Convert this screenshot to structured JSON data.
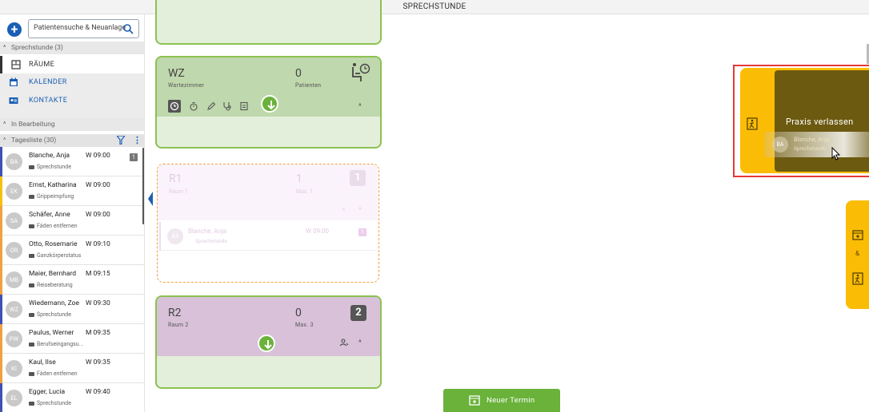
{
  "header": {
    "title": "SPRECHSTUNDE"
  },
  "search": {
    "placeholder": "Patientensuche & Neuanlage"
  },
  "sections": {
    "sprechstunde": "Sprechstunde (3)",
    "in_bearbeitung": "In Bearbeitung",
    "tagesliste": "Tagesliste (30)"
  },
  "nav": {
    "raeume": "RÄUME",
    "kalender": "KALENDER",
    "kontakte": "KONTAKTE"
  },
  "patients": [
    {
      "initials": "BA",
      "name": "Blanche, Anja",
      "time": "W 09:00",
      "reason": "Sprechstunde",
      "bar": "#3f51b5",
      "badge": "1"
    },
    {
      "initials": "EK",
      "name": "Ernst, Katharina",
      "time": "W 09:00",
      "reason": "Grippeimpfung",
      "bar": "#f4c20d",
      "badge": ""
    },
    {
      "initials": "SA",
      "name": "Schäfer, Anne",
      "time": "W 09:00",
      "reason": "Fäden entfernen",
      "bar": "#f0a040",
      "badge": ""
    },
    {
      "initials": "OR",
      "name": "Otto, Rosemarie",
      "time": "W 09:10",
      "reason": "Ganzkörperstatus",
      "bar": "#f0a040",
      "badge": ""
    },
    {
      "initials": "MB",
      "name": "Maier, Bernhard",
      "time": "M 09:15",
      "reason": "Reiseberatung",
      "bar": "#f0a040",
      "badge": ""
    },
    {
      "initials": "WZ",
      "name": "Wiedemann, Zoe",
      "time": "W 09:30",
      "reason": "Sprechstunde",
      "bar": "#3f51b5",
      "badge": ""
    },
    {
      "initials": "PW",
      "name": "Paulus, Werner",
      "time": "M 09:35",
      "reason": "Berufseingangsu...",
      "bar": "#f0a040",
      "badge": ""
    },
    {
      "initials": "KI",
      "name": "Kaul, Ilse",
      "time": "W 09:35",
      "reason": "Fäden entfernen",
      "bar": "#f0a040",
      "badge": ""
    },
    {
      "initials": "EL",
      "name": "Egger, Lucia",
      "time": "W 09:40",
      "reason": "Sprechstunde",
      "bar": "#3f51b5",
      "badge": ""
    }
  ],
  "rooms": {
    "wz": {
      "title": "WZ",
      "subtitle": "Wartezimmer",
      "count": "0",
      "count_label": "Patienten"
    },
    "r1": {
      "title": "R1",
      "subtitle": "Raum 1",
      "count": "1",
      "count_label": "Max. 1",
      "badge": "1",
      "patient": {
        "initials": "BA",
        "name": "Blanche, Anja",
        "reason": "Sprechstunde",
        "time": "W 09:00",
        "badge": "1"
      }
    },
    "r2": {
      "title": "R2",
      "subtitle": "Raum 2",
      "count": "0",
      "count_label": "Max. 3",
      "badge": "2"
    }
  },
  "praxis": {
    "label": "Praxis verlassen",
    "drag_name": "Blanche, Anja",
    "drag_reason": "Sprechstunde",
    "drag_initials": "BA"
  },
  "right_tab": {
    "amp": "&"
  },
  "new_termin": {
    "label": "Neuer Termin"
  },
  "colors": {
    "accent": "#1a5fb4",
    "green": "#8cc151",
    "yellow": "#fbbc05",
    "highlight": "#e53935"
  }
}
